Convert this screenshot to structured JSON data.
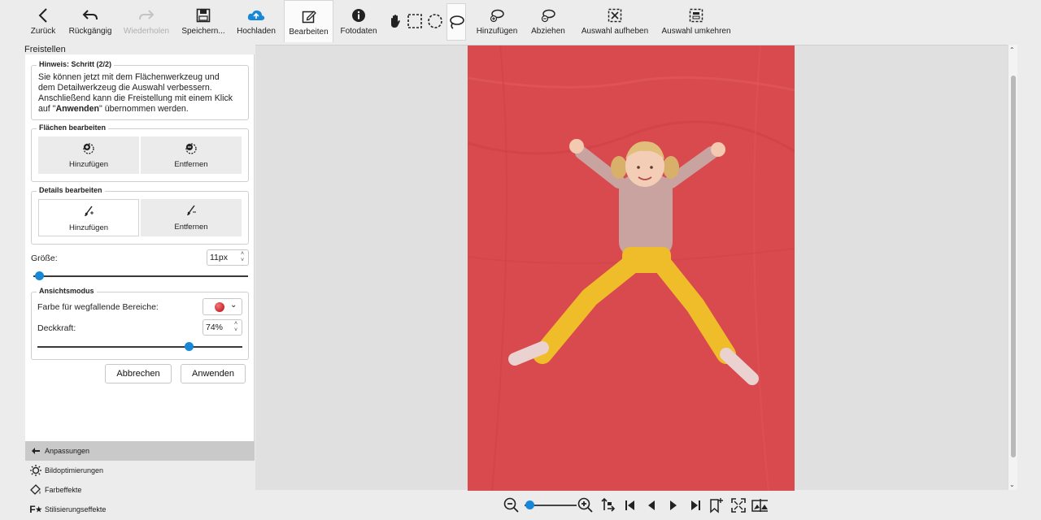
{
  "toolbar": {
    "back": "Zurück",
    "undo": "Rückgängig",
    "redo": "Wiederholen",
    "save": "Speichern...",
    "upload": "Hochladen",
    "edit": "Bearbeiten",
    "photodata": "Fotodaten",
    "add": "Hinzufügen",
    "subtract": "Abziehen",
    "deselect": "Auswahl aufheben",
    "invert": "Auswahl umkehren"
  },
  "panel": {
    "title": "Freistellen",
    "hint": {
      "legend": "Hinweis: Schritt (2/2)",
      "line1": "Sie können jetzt mit dem Flächenwerkzeug und",
      "line2": "dem Detailwerkzeug die Auswahl verbessern.",
      "line3": "Anschließend kann die Freistellung mit einem Klick",
      "line4_pre": "auf \"",
      "line4_bold": "Anwenden",
      "line4_post": "\" übernommen werden."
    },
    "areas": {
      "legend": "Flächen bearbeiten",
      "add": "Hinzufügen",
      "remove": "Entfernen"
    },
    "details": {
      "legend": "Details bearbeiten",
      "add": "Hinzufügen",
      "remove": "Entfernen"
    },
    "size": {
      "label": "Größe:",
      "value": "11px",
      "level": 0.03
    },
    "view": {
      "legend": "Ansichtsmodus",
      "color_label": "Farbe für wegfallende Bereiche:",
      "color_value": "#c8262c",
      "opacity_label": "Deckkraft:",
      "opacity_value": "74%",
      "opacity_level": 0.74
    },
    "cancel": "Abbrechen",
    "apply": "Anwenden"
  },
  "accordion": [
    {
      "label": "Anpassungen",
      "icon": "arrow-left-icon"
    },
    {
      "label": "Bildoptimierungen",
      "icon": "sun-icon"
    },
    {
      "label": "Farbeffekte",
      "icon": "palette-icon"
    },
    {
      "label": "Stilisierungseffekte",
      "icon": "fx-icon"
    }
  ],
  "colors": {
    "accent": "#1787d8",
    "overlay": "#d94a4f"
  },
  "zoom_level": 0.1
}
